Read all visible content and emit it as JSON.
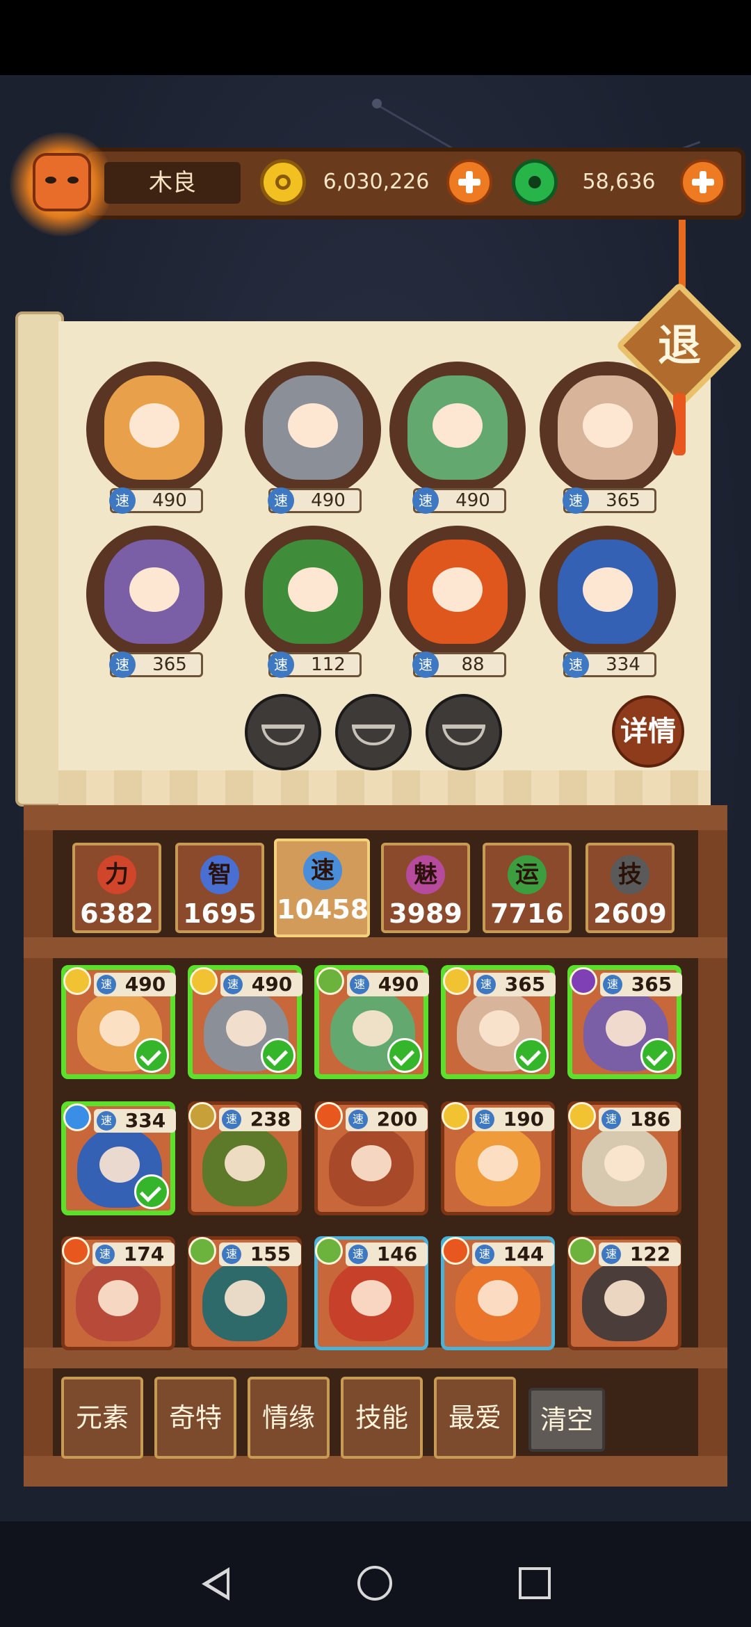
{
  "player": {
    "name": "木良"
  },
  "currency": {
    "gold": "6,030,226",
    "jade": "58,636"
  },
  "exit_label": "退",
  "speed_icon_label": "速",
  "selected_heroes": [
    {
      "speed": "490",
      "art_color": "#e9a04a"
    },
    {
      "speed": "490",
      "art_color": "#8a8f98"
    },
    {
      "speed": "490",
      "art_color": "#63a86e"
    },
    {
      "speed": "365",
      "art_color": "#d8b49a"
    },
    {
      "speed": "365",
      "art_color": "#7b5fa6"
    },
    {
      "speed": "112",
      "art_color": "#3f8c3a"
    },
    {
      "speed": "88",
      "art_color": "#e0571e"
    },
    {
      "speed": "334",
      "art_color": "#3561b4"
    }
  ],
  "empty_slot_icon": "rice-bowl-icon",
  "detail_label": "详情",
  "stats": [
    {
      "icon": "力",
      "value": "6382",
      "icon_color": "#d1452a",
      "active": false
    },
    {
      "icon": "智",
      "value": "1695",
      "icon_color": "#4a6fd2",
      "active": false
    },
    {
      "icon": "速",
      "value": "10458",
      "icon_color": "#4a8ed9",
      "active": true
    },
    {
      "icon": "魅",
      "value": "3989",
      "icon_color": "#b64a9c",
      "active": false
    },
    {
      "icon": "运",
      "value": "7716",
      "icon_color": "#3d9e3f",
      "active": false
    },
    {
      "icon": "技",
      "value": "2609",
      "icon_color": "#5a5a5a",
      "active": false
    }
  ],
  "hero_cards": [
    {
      "speed": "490",
      "element": "gold",
      "element_color": "#f1c232",
      "selected": true,
      "frame": "normal",
      "art_color": "#e9a04a"
    },
    {
      "speed": "490",
      "element": "gold",
      "element_color": "#f1c232",
      "selected": true,
      "frame": "normal",
      "art_color": "#8a8f98"
    },
    {
      "speed": "490",
      "element": "wood",
      "element_color": "#6cb33e",
      "selected": true,
      "frame": "normal",
      "art_color": "#63a86e"
    },
    {
      "speed": "365",
      "element": "gold",
      "element_color": "#f1c232",
      "selected": true,
      "frame": "normal",
      "art_color": "#d8b49a"
    },
    {
      "speed": "365",
      "element": "dark",
      "element_color": "#7f3fb5",
      "selected": true,
      "frame": "normal",
      "art_color": "#7b5fa6"
    },
    {
      "speed": "334",
      "element": "water",
      "element_color": "#3a8ee6",
      "selected": true,
      "frame": "normal",
      "art_color": "#3561b4"
    },
    {
      "speed": "238",
      "element": "earth",
      "element_color": "#c8a03a",
      "selected": false,
      "frame": "normal",
      "art_color": "#5c7a2a"
    },
    {
      "speed": "200",
      "element": "fire",
      "element_color": "#e8571e",
      "selected": false,
      "frame": "normal",
      "art_color": "#a84a2a"
    },
    {
      "speed": "190",
      "element": "gold",
      "element_color": "#f1c232",
      "selected": false,
      "frame": "normal",
      "art_color": "#f09b3a"
    },
    {
      "speed": "186",
      "element": "gold",
      "element_color": "#f1c232",
      "selected": false,
      "frame": "normal",
      "art_color": "#d6c9b0"
    },
    {
      "speed": "174",
      "element": "fire",
      "element_color": "#e8571e",
      "selected": false,
      "frame": "normal",
      "art_color": "#b84a3a"
    },
    {
      "speed": "155",
      "element": "wood",
      "element_color": "#6cb33e",
      "selected": false,
      "frame": "normal",
      "art_color": "#2f6a6a"
    },
    {
      "speed": "146",
      "element": "wood",
      "element_color": "#6cb33e",
      "selected": false,
      "frame": "blue",
      "art_color": "#c7402a"
    },
    {
      "speed": "144",
      "element": "fire",
      "element_color": "#e8571e",
      "selected": false,
      "frame": "blue",
      "art_color": "#e9742a"
    },
    {
      "speed": "122",
      "element": "wood",
      "element_color": "#6cb33e",
      "selected": false,
      "frame": "normal",
      "art_color": "#4a3d3a"
    }
  ],
  "filters": [
    {
      "label": "元素"
    },
    {
      "label": "奇特"
    },
    {
      "label": "情缘"
    },
    {
      "label": "技能"
    },
    {
      "label": "最爱"
    }
  ],
  "clear_label": "清空"
}
